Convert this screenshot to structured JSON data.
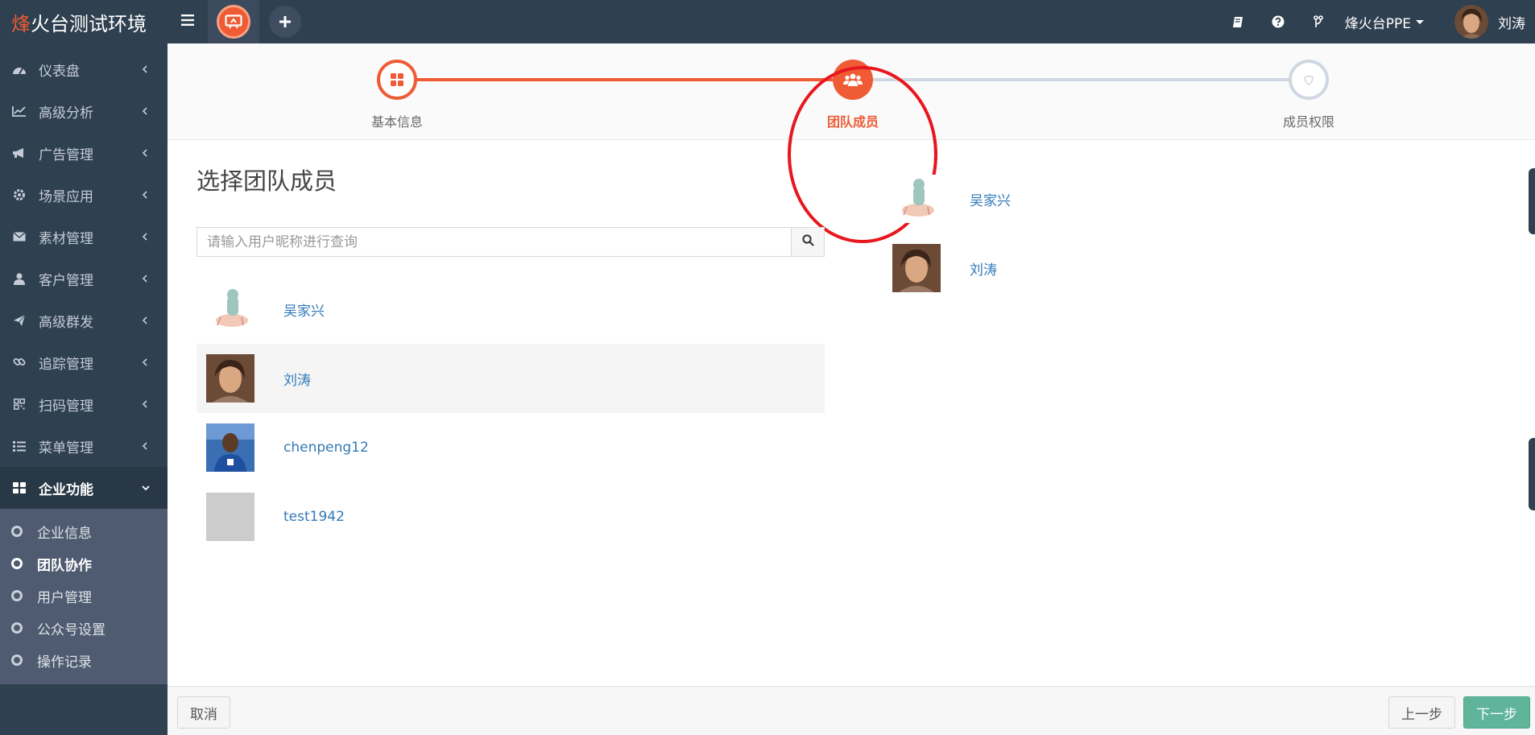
{
  "app": {
    "brand_accent": "烽",
    "brand_rest": "火台测试环境",
    "org_name": "烽火台PPE",
    "user_name": "刘涛"
  },
  "colors": {
    "sidebar_bg": "#2f4050",
    "accent": "#ef5b35",
    "link": "#337ab7",
    "primary_button": "#5fb49a",
    "highlight_ring": "#e8161e"
  },
  "sidebar": {
    "items": [
      {
        "label": "仪表盘",
        "icon": "dashboard-icon"
      },
      {
        "label": "高级分析",
        "icon": "line-chart-icon"
      },
      {
        "label": "广告管理",
        "icon": "bullhorn-icon"
      },
      {
        "label": "场景应用",
        "icon": "gear-icon"
      },
      {
        "label": "素材管理",
        "icon": "envelope-icon"
      },
      {
        "label": "客户管理",
        "icon": "user-icon"
      },
      {
        "label": "高级群发",
        "icon": "paper-plane-icon"
      },
      {
        "label": "追踪管理",
        "icon": "link-icon"
      },
      {
        "label": "扫码管理",
        "icon": "qrcode-icon"
      },
      {
        "label": "菜单管理",
        "icon": "list-icon"
      },
      {
        "label": "企业功能",
        "icon": "grid-icon"
      }
    ],
    "sub_items": [
      {
        "label": "企业信息"
      },
      {
        "label": "团队协作"
      },
      {
        "label": "用户管理"
      },
      {
        "label": "公众号设置"
      },
      {
        "label": "操作记录"
      }
    ]
  },
  "wizard": {
    "steps": [
      {
        "label": "基本信息",
        "state": "done"
      },
      {
        "label": "团队成员",
        "state": "current"
      },
      {
        "label": "成员权限",
        "state": "pending"
      }
    ]
  },
  "panel": {
    "title": "选择团队成员",
    "search_placeholder": "请输入用户昵称进行查询"
  },
  "user_list": [
    {
      "name": "吴家兴",
      "avatar": "cartoon-avatar"
    },
    {
      "name": "刘涛",
      "avatar": "photo-avatar"
    },
    {
      "name": "chenpeng12",
      "avatar": "player-avatar"
    },
    {
      "name": "test1942",
      "avatar": "blank-avatar"
    }
  ],
  "selected_list": [
    {
      "name": "吴家兴",
      "avatar": "cartoon-avatar"
    },
    {
      "name": "刘涛",
      "avatar": "photo-avatar"
    }
  ],
  "footer": {
    "cancel": "取消",
    "prev": "上一步",
    "next": "下一步"
  }
}
